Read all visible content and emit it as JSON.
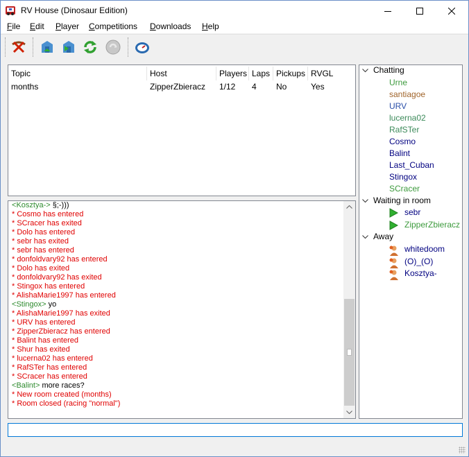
{
  "window": {
    "title": "RV House (Dinosaur Edition)"
  },
  "menu": [
    {
      "label": "File",
      "ul": "F",
      "rest": "ile"
    },
    {
      "label": "Edit",
      "ul": "E",
      "rest": "dit"
    },
    {
      "label": "Player",
      "ul": "P",
      "rest": "layer"
    },
    {
      "label": "Competitions",
      "ul": "C",
      "rest": "ompetitions"
    },
    {
      "label": "Downloads",
      "ul": "D",
      "rest": "ownloads"
    },
    {
      "label": "Help",
      "ul": "H",
      "rest": "elp"
    }
  ],
  "toolbar": {
    "icons": [
      "disconnect-icon",
      "host-room-icon",
      "join-room-icon",
      "refresh-icon",
      "stop-icon",
      "time-trial-icon"
    ]
  },
  "rooms": {
    "columns": [
      "Topic",
      "Host",
      "Players",
      "Laps",
      "Pickups",
      "RVGL"
    ],
    "rows": [
      {
        "topic": "months",
        "host": "ZipperZbieracz",
        "players": "1/12",
        "laps": "4",
        "pickups": "No",
        "rvgl": "Yes"
      }
    ]
  },
  "chat": {
    "lines": [
      {
        "type": "msg",
        "nick": "Kosztya-",
        "text": "§;-)))"
      },
      {
        "type": "sys",
        "text": "* Cosmo has entered"
      },
      {
        "type": "sys",
        "text": "* SCracer has exited"
      },
      {
        "type": "sys",
        "text": "* Dolo has entered"
      },
      {
        "type": "sys",
        "text": "* sebr has exited"
      },
      {
        "type": "sys",
        "text": "* sebr has entered"
      },
      {
        "type": "sys",
        "text": "* donfoldvary92 has entered"
      },
      {
        "type": "sys",
        "text": "* Dolo has exited"
      },
      {
        "type": "sys",
        "text": "* donfoldvary92 has exited"
      },
      {
        "type": "sys",
        "text": "* Stingox has entered"
      },
      {
        "type": "sys",
        "text": "* AlishaMarie1997 has entered"
      },
      {
        "type": "msg",
        "nick": "Stingox",
        "text": "yo"
      },
      {
        "type": "sys",
        "text": "* AlishaMarie1997 has exited"
      },
      {
        "type": "sys",
        "text": "* URV has entered"
      },
      {
        "type": "sys",
        "text": "* ZipperZbieracz has entered"
      },
      {
        "type": "sys",
        "text": "* Balint has entered"
      },
      {
        "type": "sys",
        "text": "* Shur has exited"
      },
      {
        "type": "sys",
        "text": "* lucerna02 has entered"
      },
      {
        "type": "sys",
        "text": "* RafSTer has entered"
      },
      {
        "type": "sys",
        "text": "* SCracer has entered"
      },
      {
        "type": "msg",
        "nick": "Balint",
        "text": "more races?"
      },
      {
        "type": "sys",
        "text": "* New room created (months)"
      },
      {
        "type": "sys",
        "text": "* Room closed (racing \"normal\")"
      }
    ],
    "scroll_position": 0.85
  },
  "users": {
    "groups": [
      {
        "name": "Chatting",
        "members": [
          {
            "name": "Urne",
            "color": "#3c9a3c"
          },
          {
            "name": "santiagoe",
            "color": "#a0642a"
          },
          {
            "name": "URV",
            "color": "#2a4fa8"
          },
          {
            "name": "lucerna02",
            "color": "#3c8a5a"
          },
          {
            "name": "RafSTer",
            "color": "#3c8a5a"
          },
          {
            "name": "Cosmo",
            "color": "#000080"
          },
          {
            "name": "Balint",
            "color": "#000080"
          },
          {
            "name": "Last_Cuban",
            "color": "#000080"
          },
          {
            "name": "Stingox",
            "color": "#000080"
          },
          {
            "name": "SCracer",
            "color": "#3c9a3c"
          }
        ]
      },
      {
        "name": "Waiting in room",
        "members": [
          {
            "name": "sebr",
            "color": "#000080",
            "icon": "play-arrow-icon"
          },
          {
            "name": "ZipperZbieracz",
            "color": "#3c9a3c",
            "icon": "play-arrow-icon"
          }
        ]
      },
      {
        "name": "Away",
        "members": [
          {
            "name": "whitedoom",
            "color": "#000080",
            "icon": "away-user-icon"
          },
          {
            "name": "(O)_(O)",
            "color": "#000080",
            "icon": "away-user-icon"
          },
          {
            "name": "Kosztya-",
            "color": "#000080",
            "icon": "away-user-icon"
          }
        ]
      }
    ]
  },
  "input": {
    "value": ""
  }
}
